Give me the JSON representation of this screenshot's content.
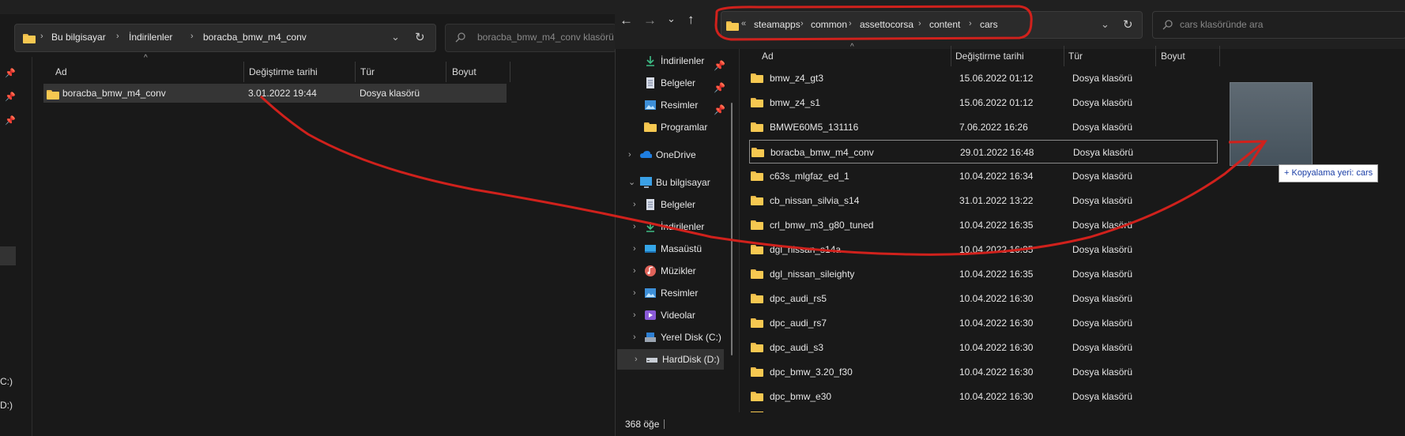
{
  "left": {
    "breadcrumb": [
      "Bu bilgisayar",
      "İndirilenler",
      "boracba_bmw_m4_conv"
    ],
    "search_placeholder": "boracba_bmw_m4_conv klasörü",
    "columns": [
      "Ad",
      "Değiştirme tarihi",
      "Tür",
      "Boyut"
    ],
    "row": {
      "name": "boracba_bmw_m4_conv",
      "date": "3.01.2022 19:44",
      "type": "Dosya klasörü"
    },
    "drives": [
      "C:)",
      "D:)"
    ]
  },
  "right": {
    "breadcrumb": [
      "steamapps",
      "common",
      "assettocorsa",
      "content",
      "cars"
    ],
    "breadcrumb_prefix": "«",
    "search_placeholder": "cars klasöründe ara",
    "columns": [
      "Ad",
      "Değiştirme tarihi",
      "Tür",
      "Boyut"
    ],
    "nav": [
      {
        "label": "İndirilenler",
        "icon": "download-icon",
        "pinned": true,
        "chevron": false,
        "indent": 1
      },
      {
        "label": "Belgeler",
        "icon": "document-icon",
        "pinned": true,
        "chevron": false,
        "indent": 1
      },
      {
        "label": "Resimler",
        "icon": "picture-icon",
        "pinned": true,
        "chevron": false,
        "indent": 1
      },
      {
        "label": "Programlar",
        "icon": "folder-icon",
        "pinned": false,
        "chevron": false,
        "indent": 1
      },
      {
        "label": "OneDrive",
        "icon": "cloud-icon",
        "pinned": false,
        "chevron": true,
        "indent": 0
      },
      {
        "label": "Bu bilgisayar",
        "icon": "computer-icon",
        "pinned": false,
        "chevron": true,
        "expanded": true,
        "indent": 0
      },
      {
        "label": "Belgeler",
        "icon": "document-icon",
        "pinned": false,
        "chevron": true,
        "indent": 1
      },
      {
        "label": "İndirilenler",
        "icon": "download-icon",
        "pinned": false,
        "chevron": true,
        "indent": 1
      },
      {
        "label": "Masaüstü",
        "icon": "desktop-icon",
        "pinned": false,
        "chevron": true,
        "indent": 1
      },
      {
        "label": "Müzikler",
        "icon": "music-icon",
        "pinned": false,
        "chevron": true,
        "indent": 1
      },
      {
        "label": "Resimler",
        "icon": "picture-icon",
        "pinned": false,
        "chevron": true,
        "indent": 1
      },
      {
        "label": "Videolar",
        "icon": "video-icon",
        "pinned": false,
        "chevron": true,
        "indent": 1
      },
      {
        "label": "Yerel Disk (C:)",
        "icon": "drive-icon",
        "pinned": false,
        "chevron": true,
        "indent": 1
      },
      {
        "label": "HardDisk (D:)",
        "icon": "drive-icon",
        "pinned": false,
        "chevron": true,
        "indent": 1,
        "selected": true
      }
    ],
    "rows": [
      {
        "name": "bmw_z4_gt3",
        "date": "15.06.2022 01:12",
        "type": "Dosya klasörü"
      },
      {
        "name": "bmw_z4_s1",
        "date": "15.06.2022 01:12",
        "type": "Dosya klasörü"
      },
      {
        "name": "BMWE60M5_131116",
        "date": "7.06.2022 16:26",
        "type": "Dosya klasörü"
      },
      {
        "name": "boracba_bmw_m4_conv",
        "date": "29.01.2022 16:48",
        "type": "Dosya klasörü",
        "focused": true
      },
      {
        "name": "c63s_mlgfaz_ed_1",
        "date": "10.04.2022 16:34",
        "type": "Dosya klasörü"
      },
      {
        "name": "cb_nissan_silvia_s14",
        "date": "31.01.2022 13:22",
        "type": "Dosya klasörü"
      },
      {
        "name": "crl_bmw_m3_g80_tuned",
        "date": "10.04.2022 16:35",
        "type": "Dosya klasörü"
      },
      {
        "name": "dgl_nissan_s14a",
        "date": "10.04.2022 16:35",
        "type": "Dosya klasörü"
      },
      {
        "name": "dgl_nissan_sileighty",
        "date": "10.04.2022 16:35",
        "type": "Dosya klasörü"
      },
      {
        "name": "dpc_audi_rs5",
        "date": "10.04.2022 16:30",
        "type": "Dosya klasörü"
      },
      {
        "name": "dpc_audi_rs7",
        "date": "10.04.2022 16:30",
        "type": "Dosya klasörü"
      },
      {
        "name": "dpc_audi_s3",
        "date": "10.04.2022 16:30",
        "type": "Dosya klasörü"
      },
      {
        "name": "dpc_bmw_3.20_f30",
        "date": "10.04.2022 16:30",
        "type": "Dosya klasörü"
      },
      {
        "name": "dpc_bmw_e30",
        "date": "10.04.2022 16:30",
        "type": "Dosya klasörü"
      }
    ],
    "status": "368 öğe",
    "drag_tooltip": "+ Kopyalama yeri: cars"
  },
  "colors": {
    "annotation": "#d0211c",
    "folder": "#f6c851",
    "accent": "#4aa3ff"
  }
}
